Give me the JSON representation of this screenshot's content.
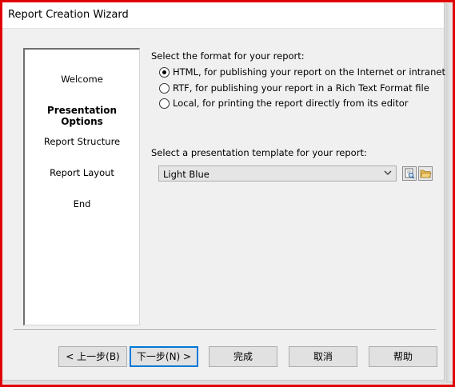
{
  "window": {
    "title": "Report Creation Wizard"
  },
  "steps": [
    {
      "label": "Welcome",
      "active": false
    },
    {
      "label": "Presentation Options",
      "active": true
    },
    {
      "label": "Report Structure",
      "active": false
    },
    {
      "label": "Report Layout",
      "active": false
    },
    {
      "label": "End",
      "active": false
    }
  ],
  "format": {
    "prompt": "Select the format for your report:",
    "options": [
      {
        "label": "HTML, for publishing your report on the Internet or intranet",
        "selected": true
      },
      {
        "label": "RTF, for publishing your report in a Rich Text Format file",
        "selected": false
      },
      {
        "label": "Local, for printing the report directly from its editor",
        "selected": false
      }
    ]
  },
  "template": {
    "prompt": "Select a presentation template for your report:",
    "value": "Light Blue",
    "icons": [
      "preview-icon",
      "open-folder-icon"
    ]
  },
  "buttons": {
    "back": "< 上一步(B)",
    "next": "下一步(N) >",
    "finish": "完成",
    "cancel": "取消",
    "help": "帮助"
  },
  "colors": {
    "highlight_frame": "#e00000",
    "default_button_border": "#0078d7",
    "folder_icon": "#e8b84a"
  }
}
